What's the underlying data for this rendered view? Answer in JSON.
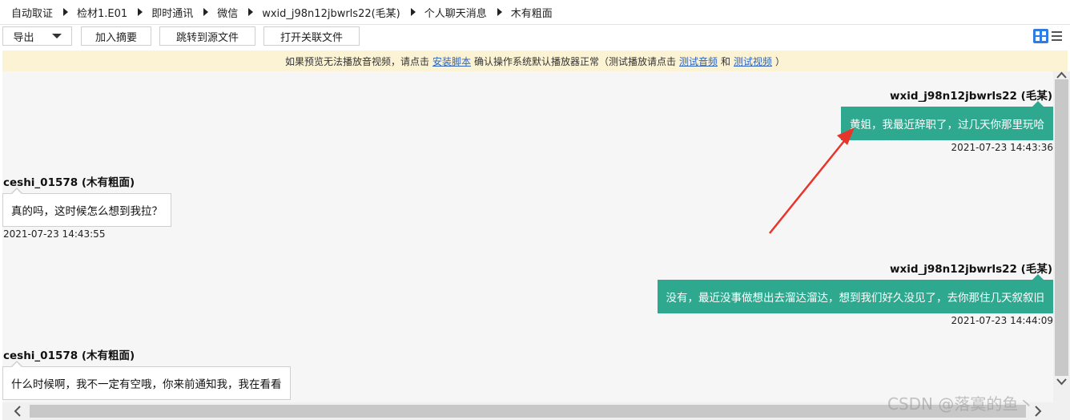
{
  "breadcrumb": [
    "自动取证",
    "检材1.E01",
    "即时通讯",
    "微信",
    "wxid_j98n12jbwrls22(毛某)",
    "个人聊天消息",
    "木有粗面"
  ],
  "toolbar": {
    "export_label": "导出",
    "add_summary_label": "加入摘要",
    "jump_source_label": "跳转到源文件",
    "open_related_label": "打开关联文件",
    "view_grid_icon": "grid-view-icon",
    "view_list_icon": "list-view-icon",
    "accent_color": "#2f7de1"
  },
  "notice": {
    "text1": "如果预览无法播放音视频，请点击",
    "link_install": "安装脚本",
    "text2": "确认操作系统默认播放器正常（测试播放请点击",
    "link_audio": "测试音频",
    "text3": "和",
    "link_video": "测试视频",
    "text4": "）"
  },
  "messages": [
    {
      "direction": "out",
      "sender": "wxid_j98n12jbwrls22 (毛某)",
      "text": "黄姐，我最近辞职了，过几天你那里玩哈",
      "time": "2021-07-23 14:43:36"
    },
    {
      "direction": "in",
      "sender": "ceshi_01578 (木有粗面)",
      "text": "真的吗，这时候怎么想到我拉？",
      "time": "2021-07-23 14:43:55"
    },
    {
      "direction": "out",
      "sender": "wxid_j98n12jbwrls22 (毛某)",
      "text": "没有，最近没事做想出去溜达溜达，想到我们好久没见了，去你那住几天叙叙旧",
      "time": "2021-07-23 14:44:09"
    },
    {
      "direction": "in",
      "sender": "ceshi_01578 (木有粗面)",
      "text": "什么时候啊，我不一定有空哦，你来前通知我，我在看看",
      "time": ""
    }
  ],
  "colors": {
    "outgoing_bubble": "#2ea98f",
    "notice_bg": "#fbf3d3",
    "annotation_arrow": "#e8352b"
  },
  "watermark": "CSDN @落寞的鱼丶"
}
